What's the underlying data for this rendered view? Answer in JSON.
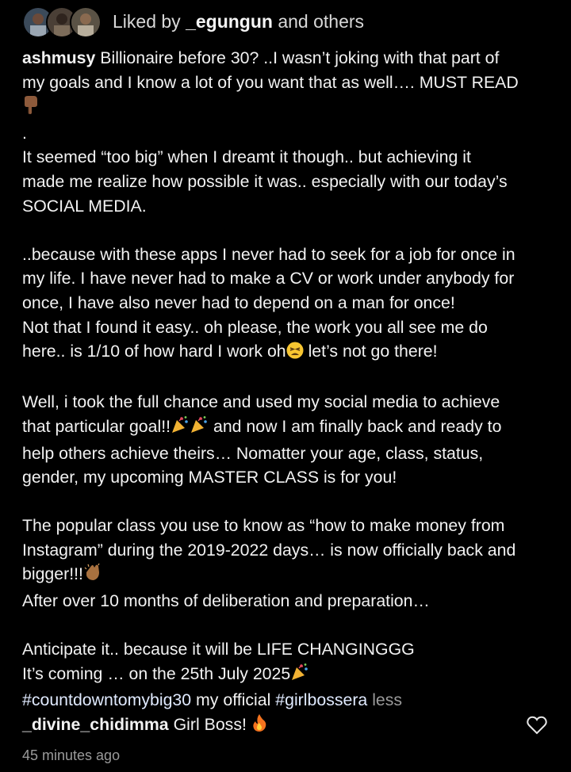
{
  "likes": {
    "prefix": "Liked by",
    "user": "_egungun",
    "suffix": "and others"
  },
  "caption": {
    "username": "ashmusy",
    "lines": [
      "Billionaire before 30? ..I wasn’t joking with that part of",
      "my goals and I know a lot of you want that as well…. MUST READ",
      ".",
      "It seemed “too big” when I dreamt it though.. but achieving it",
      "made me realize how possible it was.. especially with our today’s",
      "SOCIAL MEDIA.",
      "..because with these apps I never had to seek for a job for once in",
      "my life. I have never had to make a CV or work under anybody for",
      "once, I have also never had to depend on a man for once!",
      "Not that I found it easy.. oh please, the work you all see me do",
      "here.. is 1/10 of how hard I work oh",
      "let’s not go there!",
      "Well, i took the full chance and used my social media to achieve",
      "that particular goal!!",
      "and now I am finally back and ready to",
      "help others achieve theirs… Nomatter your age, class, status,",
      "gender,  my upcoming MASTER CLASS is for you!",
      "The popular class you use to know as “how to make money from",
      "Instagram” during the 2019-2022 days… is now officially back and",
      "bigger!!!",
      "After over 10 months of deliberation and preparation…",
      "Anticipate it.. because it will be LIFE CHANGINGGG",
      "It’s coming … on the 25th July 2025",
      "#countdowntomybig30",
      "my official",
      "#girlbossera",
      "less"
    ]
  },
  "comment": {
    "username": "_divine_chidimma",
    "text": "Girl Boss!"
  },
  "timestamp": "45 minutes ago",
  "icons": {
    "pointing": "pointing-down-icon",
    "weary": "weary-face-icon",
    "party": "party-popper-icon",
    "clap": "clapping-hands-icon",
    "fire": "fire-icon",
    "like": "heart-icon"
  }
}
